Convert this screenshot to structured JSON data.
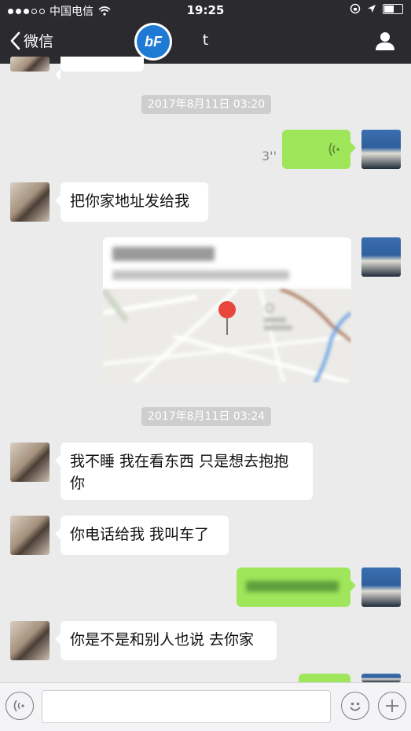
{
  "status_bar": {
    "carrier": "中国电信",
    "time": "19:25",
    "battery_level": 0.5
  },
  "nav": {
    "back_label": "微信",
    "title": "t",
    "logo_text": "bF"
  },
  "chat": {
    "timestamps": [
      "2017年8月11日 03:20",
      "2017年8月11日 03:24"
    ],
    "voice_duration": "3''",
    "messages": {
      "m1": "把你家地址发给我",
      "m2": "我不睡 我在看东西 只是想去抱抱你",
      "m3": "你电话给我 我叫车了",
      "m4": "你是不是和别人也说 去你家"
    }
  },
  "colors": {
    "bar": "#2b2b2f",
    "sent_bubble": "#9fe65a",
    "background": "#ebebeb",
    "pin": "#e8453c"
  }
}
